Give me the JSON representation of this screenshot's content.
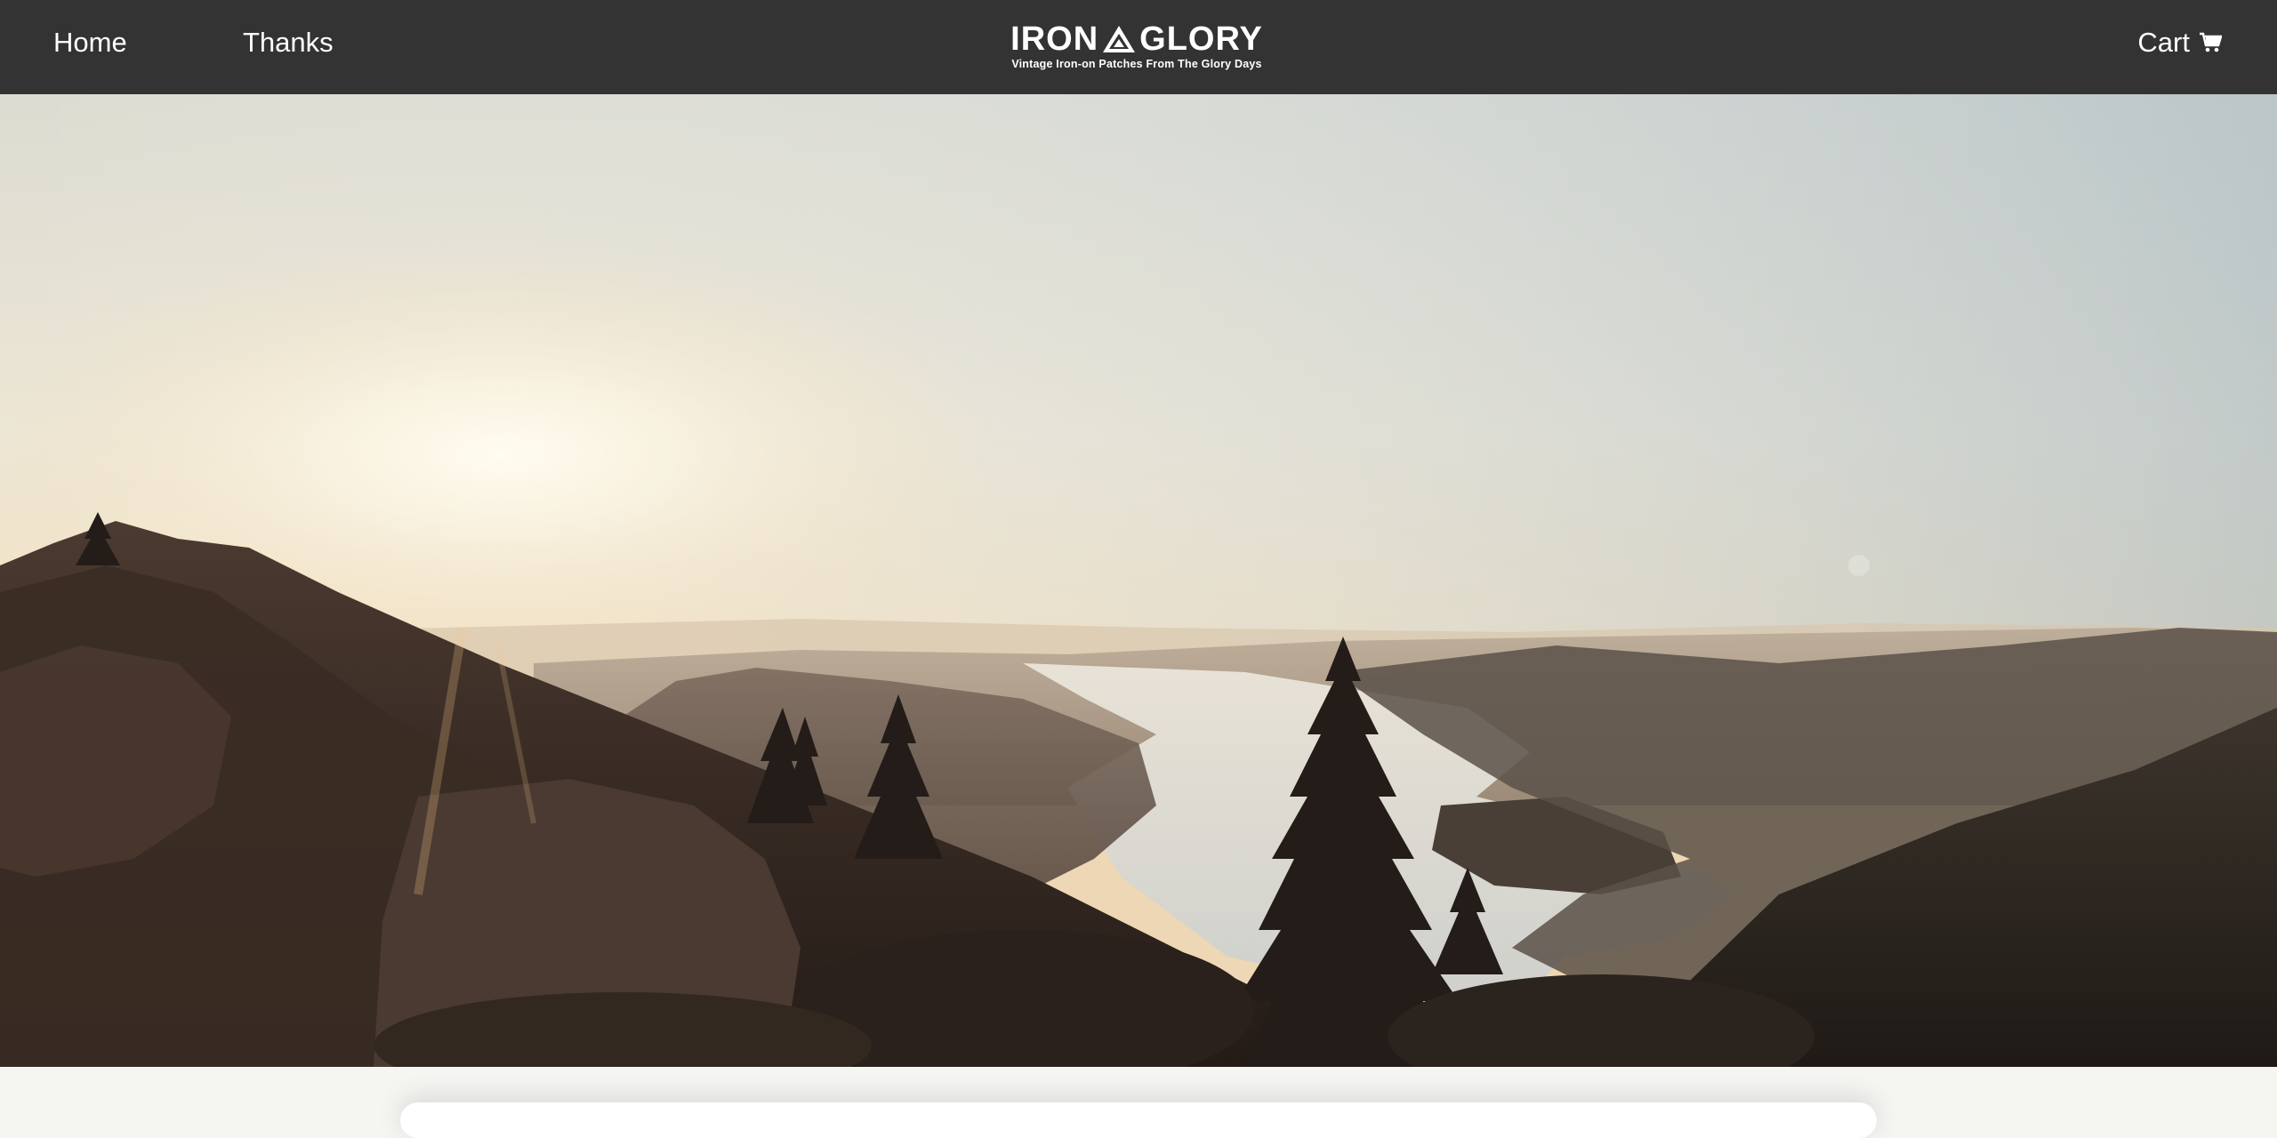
{
  "nav": {
    "home_label": "Home",
    "thanks_label": "Thanks",
    "cart_label": "Cart",
    "cart_icon": "cart-icon"
  },
  "logo": {
    "word_left": "IRON",
    "word_right": "GLORY",
    "tagline": "Vintage Iron-on Patches From The Glory Days",
    "mark_icon": "mountain-triangle-icon"
  },
  "hero": {
    "image": "mountain-river-sunset-photo"
  },
  "colors": {
    "navbar": "#333333",
    "nav_text": "#ffffff",
    "page_background": "#f5f5f2"
  }
}
